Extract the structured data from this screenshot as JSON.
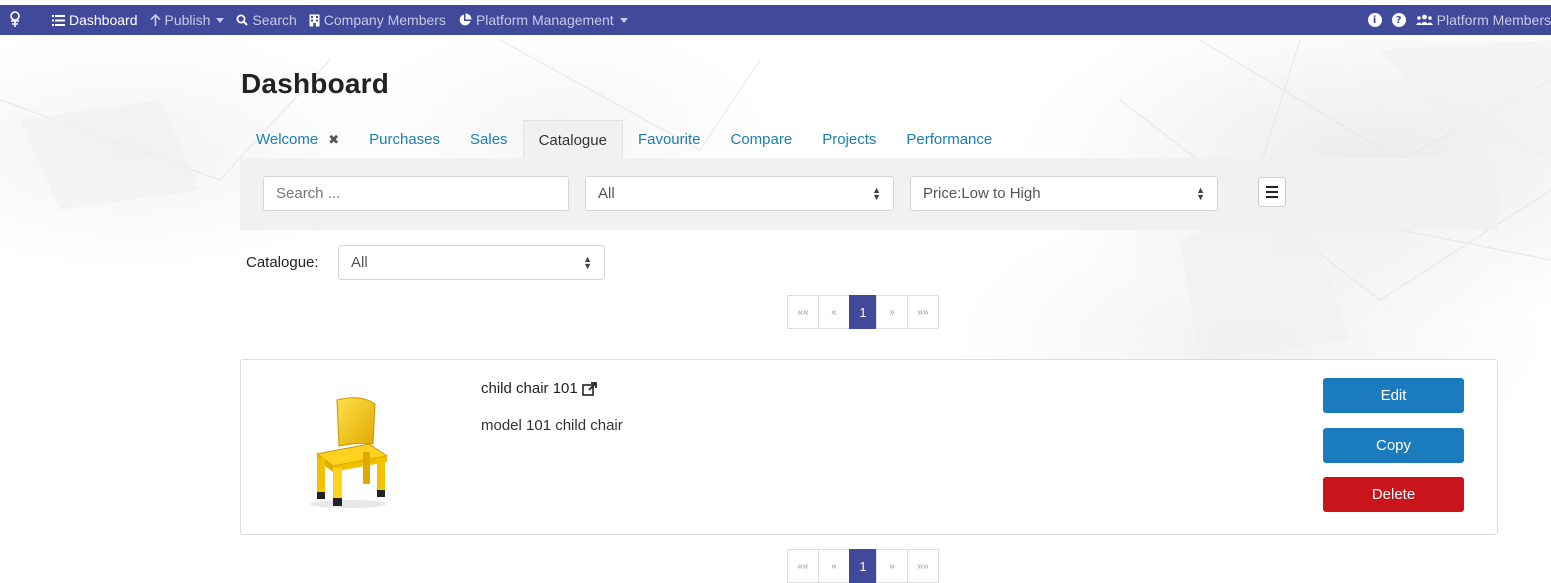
{
  "navbar": {
    "logo_icon": "platform-logo-icon",
    "items": [
      {
        "icon": "list-icon",
        "label": "Dashboard",
        "active": true
      },
      {
        "icon": "arrow-up-icon",
        "label": "Publish",
        "dropdown": true
      },
      {
        "icon": "search-icon",
        "label": "Search"
      },
      {
        "icon": "building-icon",
        "label": "Company Members"
      },
      {
        "icon": "pie-chart-icon",
        "label": "Platform Management",
        "dropdown": true
      }
    ],
    "right": {
      "info_icon": "i",
      "help_icon": "?",
      "members_label": "Platform Members"
    },
    "color": "#41499b"
  },
  "page": {
    "title": "Dashboard"
  },
  "tabs": [
    {
      "label": "Welcome",
      "closable": true
    },
    {
      "label": "Purchases"
    },
    {
      "label": "Sales"
    },
    {
      "label": "Catalogue",
      "active": true
    },
    {
      "label": "Favourite"
    },
    {
      "label": "Compare"
    },
    {
      "label": "Projects"
    },
    {
      "label": "Performance"
    }
  ],
  "filters": {
    "search_placeholder": "Search ...",
    "category_value": "All",
    "sort_value": "Price:Low to High"
  },
  "catalogue": {
    "label": "Catalogue:",
    "value": "All"
  },
  "pagination": {
    "first": "««",
    "prev": "«",
    "current": "1",
    "next": "»",
    "last": "»»"
  },
  "item": {
    "title": "child chair 101",
    "description": "model 101 child chair",
    "image_icon": "yellow-child-chair-image",
    "edit_label": "Edit",
    "copy_label": "Copy",
    "delete_label": "Delete"
  },
  "colors": {
    "primary": "#41499b",
    "button_blue": "#1a7cbf",
    "button_red": "#c9141b",
    "link": "#1a7fb5"
  }
}
